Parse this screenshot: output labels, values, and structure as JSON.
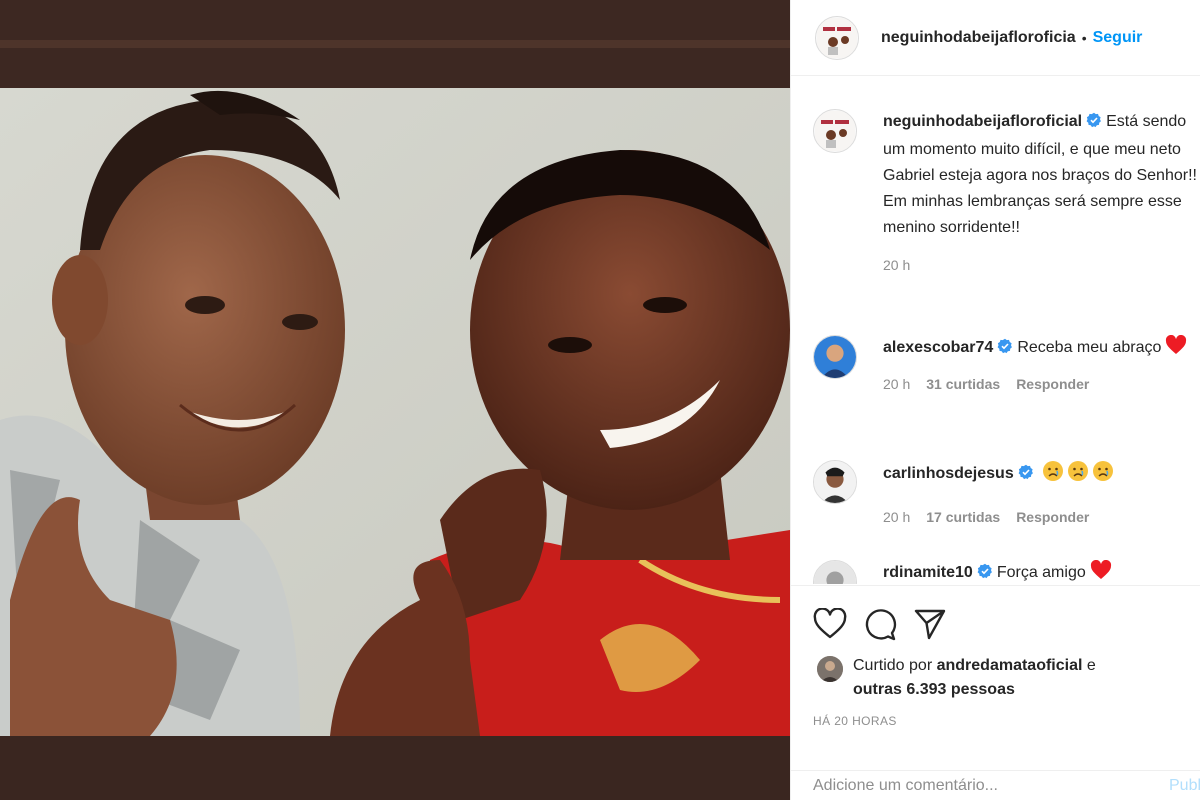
{
  "post": {
    "author": "neguinhodabeijafloroficia",
    "separator": "•",
    "follow_label": "Seguir"
  },
  "caption": {
    "author": "neguinhodabeijafloroficial",
    "text_line1": "Está sendo um momento muito difícil, e que meu neto Gabriel esteja agora nos braços do Senhor!!",
    "text_line2": "Em minhas lembranças será sempre esse menino sorridente!!",
    "time": "20 h"
  },
  "comments": [
    {
      "author": "alexescobar74",
      "text": "Receba meu abraço",
      "time": "20 h",
      "likes": "31 curtidas",
      "reply": "Responder",
      "emoji": "heart"
    },
    {
      "author": "carlinhosdejesus",
      "text": "",
      "time": "20 h",
      "likes": "17 curtidas",
      "reply": "Responder",
      "emoji": "sad-faces"
    },
    {
      "author": "rdinamite10",
      "text": "Força amigo",
      "emoji": "heart"
    }
  ],
  "likes": {
    "prefix": "Curtido por",
    "user": "andredamataoficial",
    "and": "e",
    "others": "outras 6.393 pessoas"
  },
  "timestamp": "HÁ 20 HORAS",
  "add_comment": {
    "placeholder": "Adicione um comentário...",
    "publish": "Publicar"
  },
  "icons": {
    "like": "heart-outline-icon",
    "comment": "comment-bubble-icon",
    "share": "paper-plane-icon",
    "verified": "verified-badge-icon"
  },
  "colors": {
    "link": "#0095f6",
    "verified": "#3897f0",
    "muted": "#8e8e8e",
    "heart": "#ed1c24"
  }
}
